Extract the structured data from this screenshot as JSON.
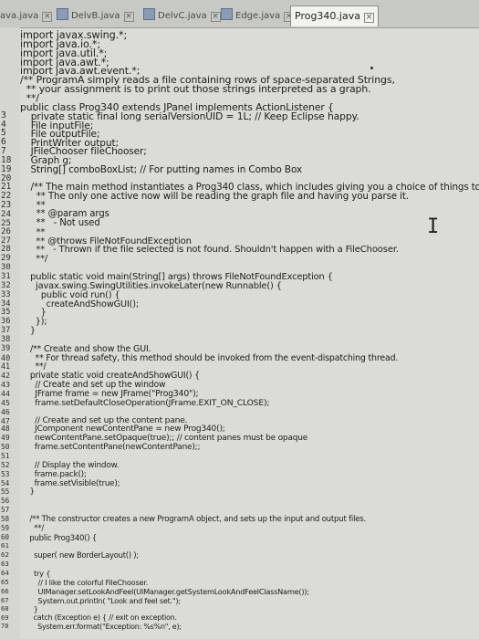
{
  "tabs": [
    {
      "label": "ava.java",
      "active": false
    },
    {
      "label": "DelvB.java",
      "active": false
    },
    {
      "label": "DelvC.java",
      "active": false
    },
    {
      "label": "Edge.java",
      "active": false
    },
    {
      "label": "Prog340.java",
      "active": true
    }
  ],
  "code": [
    {
      "num": "",
      "text": "import javax.swing.*;"
    },
    {
      "num": "",
      "text": "import java.io.*;"
    },
    {
      "num": "",
      "text": "import java.util.*;"
    },
    {
      "num": "",
      "text": "import java.awt.*;"
    },
    {
      "num": "",
      "text": "import java.awt.event.*;"
    },
    {
      "num": "",
      "text": "/** ProgramA simply reads a file containing rows of space-separated Strings,"
    },
    {
      "num": "",
      "text": "  ** your assignment is to print out those strings interpreted as a graph."
    },
    {
      "num": "",
      "text": "  **/"
    },
    {
      "num": "",
      "text": "public class Prog340 extends JPanel implements ActionListener {"
    },
    {
      "num": "3",
      "text": "private static final long serialVersionUID = 1L; // Keep Eclipse happy."
    },
    {
      "num": "4",
      "text": "File inputFile;"
    },
    {
      "num": "5",
      "text": "File outputFile;"
    },
    {
      "num": "6",
      "text": "PrintWriter output;"
    },
    {
      "num": "7",
      "text": "JFileChooser fileChooser;"
    },
    {
      "num": "18",
      "text": "Graph g;"
    },
    {
      "num": "19",
      "text": "String[] comboBoxList; // For putting names in Combo Box"
    },
    {
      "num": "20",
      "text": ""
    },
    {
      "num": "21",
      "text": "/** The main method instantiates a Prog340 class, which includes giving you a choice of things to do."
    },
    {
      "num": "22",
      "text": "  ** The only one active now will be reading the graph file and having you parse it."
    },
    {
      "num": "23",
      "text": "  **"
    },
    {
      "num": "24",
      "text": "  ** @param args"
    },
    {
      "num": "25",
      "text": "  **   - Not used"
    },
    {
      "num": "26",
      "text": "  **"
    },
    {
      "num": "27",
      "text": "  ** @throws FileNotFoundException"
    },
    {
      "num": "28",
      "text": "  **   - Thrown if the file selected is not found. Shouldn't happen with a FileChooser."
    },
    {
      "num": "29",
      "text": "  **/"
    },
    {
      "num": "30",
      "text": ""
    },
    {
      "num": "31",
      "text": "public static void main(String[] args) throws FileNotFoundException {"
    },
    {
      "num": "32",
      "text": "  javax.swing.SwingUtilities.invokeLater(new Runnable() {"
    },
    {
      "num": "33",
      "text": "    public void run() {"
    },
    {
      "num": "34",
      "text": "      createAndShowGUI();"
    },
    {
      "num": "35",
      "text": "    }"
    },
    {
      "num": "36",
      "text": "  });"
    },
    {
      "num": "37",
      "text": "}"
    },
    {
      "num": "38",
      "text": ""
    },
    {
      "num": "39",
      "text": "/** Create and show the GUI."
    },
    {
      "num": "40",
      "text": "  ** For thread safety, this method should be invoked from the event-dispatching thread."
    },
    {
      "num": "41",
      "text": "  **/"
    },
    {
      "num": "42",
      "text": "private static void createAndShowGUI() {"
    },
    {
      "num": "43",
      "text": "  // Create and set up the window"
    },
    {
      "num": "44",
      "text": "  JFrame frame = new JFrame(\"Prog340\");"
    },
    {
      "num": "45",
      "text": "  frame.setDefaultCloseOperation(JFrame.EXIT_ON_CLOSE);"
    },
    {
      "num": "46",
      "text": ""
    },
    {
      "num": "47",
      "text": "  // Create and set up the content pane."
    },
    {
      "num": "48",
      "text": "  JComponent newContentPane = new Prog340();"
    },
    {
      "num": "49",
      "text": "  newContentPane.setOpaque(true);; // content panes must be opaque"
    },
    {
      "num": "50",
      "text": "  frame.setContentPane(newContentPane);;"
    },
    {
      "num": "51",
      "text": ""
    },
    {
      "num": "52",
      "text": "  // Display the window."
    },
    {
      "num": "53",
      "text": "  frame.pack();"
    },
    {
      "num": "54",
      "text": "  frame.setVisible(true);"
    },
    {
      "num": "55",
      "text": "}"
    },
    {
      "num": "56",
      "text": ""
    },
    {
      "num": "57",
      "text": ""
    },
    {
      "num": "58",
      "text": "/** The constructor creates a new ProgramA object, and sets up the input and output files."
    },
    {
      "num": "59",
      "text": "  **/"
    },
    {
      "num": "60",
      "text": "public Prog340() {"
    },
    {
      "num": "61",
      "text": ""
    },
    {
      "num": "62",
      "text": "  super( new BorderLayout() );"
    },
    {
      "num": "63",
      "text": ""
    },
    {
      "num": "64",
      "text": "  try {"
    },
    {
      "num": "65",
      "text": "    // I like the colorful FileChooser."
    },
    {
      "num": "66",
      "text": "    UIManager.setLookAndFeel(UIManager.getSystemLookAndFeelClassName());"
    },
    {
      "num": "67",
      "text": "    System.out.println( \"Look and feel set.\");"
    },
    {
      "num": "68",
      "text": "  }"
    },
    {
      "num": "69",
      "text": "  catch (Exception e) { // exit on exception."
    },
    {
      "num": "70",
      "text": "    System.err.format(\"Exception: %s%n\", e);"
    }
  ]
}
